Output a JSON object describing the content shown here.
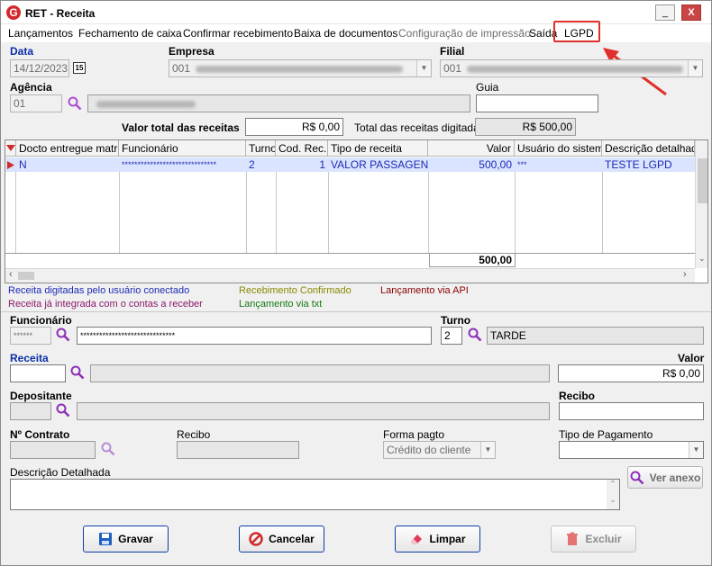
{
  "window": {
    "title": "RET - Receita",
    "minimize": "_",
    "close": "X"
  },
  "menu": [
    "Lançamentos",
    "Fechamento de caixa",
    "Confirmar recebimento",
    "Baixa de documentos",
    "Configuração de impressão",
    "Saída",
    "LGPD"
  ],
  "header": {
    "data_label": "Data",
    "data_value": "14/12/2023",
    "empresa_label": "Empresa",
    "empresa_value": "001",
    "filial_label": "Filial",
    "filial_value": "001",
    "agencia_label": "Agência",
    "agencia_value": "01",
    "guia_label": "Guia",
    "guia_value": "",
    "valor_total_label": "Valor total das receitas",
    "valor_total_value": "R$ 0,00",
    "total_digitadas_label": "Total das receitas digitadas",
    "total_digitadas_value": "R$ 500,00"
  },
  "grid": {
    "columns": [
      "Docto entregue matriz",
      "Funcionário",
      "Turno",
      "Cod. Rec.",
      "Tipo de receita",
      "Valor",
      "Usuário do sistema",
      "Descrição detalhada"
    ],
    "row": {
      "docto": "N",
      "funcionario": "******************************",
      "turno": "2",
      "cod_rec": "1",
      "tipo": "VALOR PASSAGEN...",
      "valor": "500,00",
      "usuario": "***",
      "descricao": "TESTE LGPD"
    },
    "total": "500,00"
  },
  "legend": {
    "conectado": "Receita digitadas pelo usuário conectado",
    "integrada": "Receita já integrada com o contas a receber",
    "confirmado": "Recebimento Confirmado",
    "txt": "Lançamento via txt",
    "api": "Lançamento via API"
  },
  "colors": {
    "legend_blue": "#1d2bb5",
    "legend_purple": "#8b1a6b",
    "legend_olive": "#8a8a00",
    "legend_green": "#117a11",
    "legend_darkred": "#8b0000"
  },
  "form": {
    "funcionario_label": "Funcionário",
    "funcionario_code": "******",
    "funcionario_name": "******************************",
    "turno_label": "Turno",
    "turno_code": "2",
    "turno_name": "TARDE",
    "receita_label": "Receita",
    "valor_label": "Valor",
    "valor_value": "R$ 0,00",
    "depositante_label": "Depositante",
    "recibo_label": "Recibo",
    "contrato_label": "Nº Contrato",
    "recibo2_label": "Recibo",
    "forma_pagto_label": "Forma pagto",
    "forma_pagto_value": "Crédito do cliente",
    "tipo_pagamento_label": "Tipo de Pagamento",
    "descricao_label": "Descrição Detalhada",
    "ver_anexo": "Ver anexo"
  },
  "buttons": {
    "gravar": "Gravar",
    "cancelar": "Cancelar",
    "limpar": "Limpar",
    "excluir": "Excluir"
  }
}
